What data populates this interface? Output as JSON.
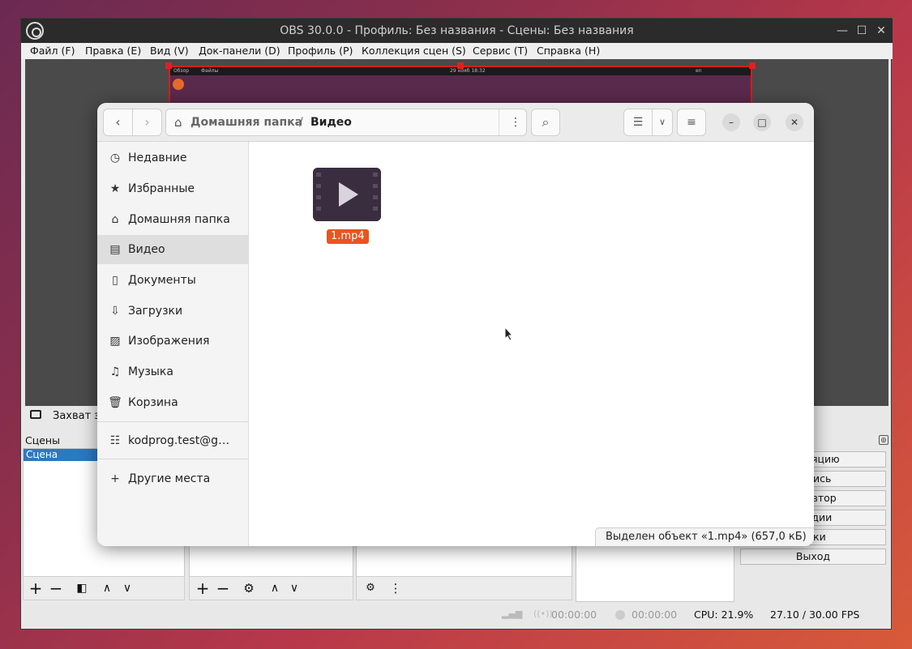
{
  "obs": {
    "title": "OBS 30.0.0 - Профиль: Без названия - Сцены: Без названия",
    "menu": [
      "Файл (F)",
      "Правка (E)",
      "Вид (V)",
      "Док-панели (D)",
      "Профиль (P)",
      "Коллекция сцен (S)",
      "Сервис (T)",
      "Справка (H)"
    ],
    "capture_bar_left": "Обзор",
    "capture_bar_app": "Файлы",
    "capture_bar_center": "29 нояб 18:32",
    "capture_bar_right": "en",
    "source_label": "Захват эк",
    "scenes_label": "Сцены",
    "scene_item": "Сцена",
    "controls": [
      "ансляцию",
      "запись",
      "ь повтор",
      "студии",
      "ойки",
      "Выход"
    ],
    "status": {
      "stream_time": "00:00:00",
      "rec_time": "00:00:00",
      "cpu": "CPU: 21.9%",
      "fps": "27.10 / 30.00 FPS"
    }
  },
  "files": {
    "path_home": "Домашняя папка",
    "path_sep": "/",
    "path_current": "Видео",
    "sidebar": [
      {
        "label": "Недавние",
        "icon": "clock-icon"
      },
      {
        "label": "Избранные",
        "icon": "star-icon"
      },
      {
        "label": "Домашняя папка",
        "icon": "home-icon"
      },
      {
        "label": "Видео",
        "icon": "film-icon"
      },
      {
        "label": "Документы",
        "icon": "document-icon"
      },
      {
        "label": "Загрузки",
        "icon": "download-icon"
      },
      {
        "label": "Изображения",
        "icon": "image-icon"
      },
      {
        "label": "Музыка",
        "icon": "music-icon"
      },
      {
        "label": "Корзина",
        "icon": "trash-icon"
      },
      {
        "label": "kodprog.test@g…",
        "icon": "server-icon"
      },
      {
        "label": "Другие места",
        "icon": "plus-icon"
      }
    ],
    "file_name": "1.mp4",
    "status": "Выделен объект «1.mp4» (657,0 кБ)"
  },
  "colors": {
    "selection_orange": "#e95420",
    "obs_scene_selected": "#2a7ac0",
    "capture_border": "#d21f1f"
  }
}
